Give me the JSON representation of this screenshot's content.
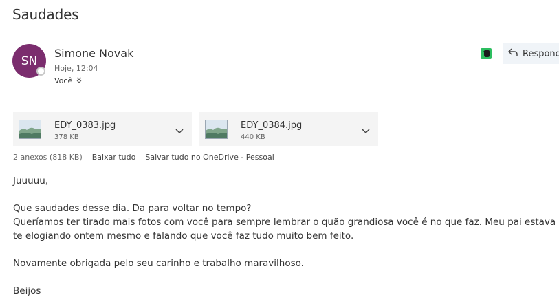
{
  "subject": "Saudades",
  "sender": {
    "initials": "SN",
    "name": "Simone Novak",
    "time": "Hoje, 12:04",
    "to": "Você",
    "avatar_color": "#7b2d6e"
  },
  "toolbar": {
    "reply_label": "Respond",
    "evernote_color": "#2dbe60"
  },
  "attachments": [
    {
      "name": "EDY_0383.jpg",
      "size": "378 KB"
    },
    {
      "name": "EDY_0384.jpg",
      "size": "440 KB"
    }
  ],
  "attachment_info": {
    "count": "2 anexos (818 KB)",
    "download_all": "Baixar tudo",
    "save_onedrive": "Salvar tudo no OneDrive - Pessoal"
  },
  "message": {
    "greeting": "Juuuuu,",
    "line1": "Que saudades desse dia. Da para voltar no tempo?",
    "line2": "Queríamos ter tirado mais fotos com você para sempre lembrar o quão grandiosa você é no que faz. Meu pai estava te elogiando ontem mesmo e falando que você faz tudo muito bem feito.",
    "line3": "Novamente obrigada pelo seu carinho e trabalho maravilhoso.",
    "closing": "Beijos"
  }
}
